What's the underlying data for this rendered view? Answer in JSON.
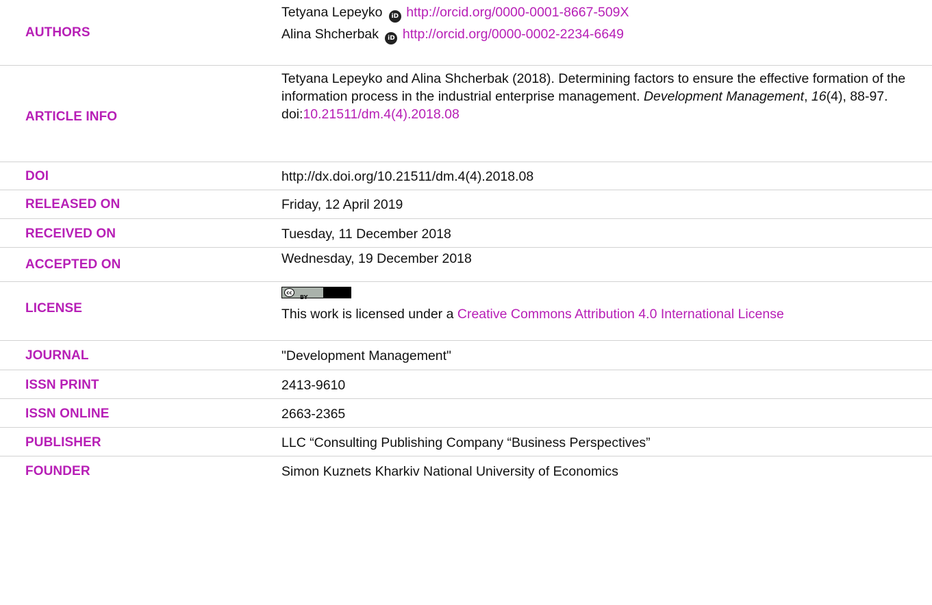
{
  "authors": {
    "label": "AUTHORS",
    "list": [
      {
        "name": "Tetyana Lepeyko",
        "orcid": "http://orcid.org/0000-0001-8667-509X"
      },
      {
        "name": "Alina Shcherbak",
        "orcid": "http://orcid.org/0000-0002-2234-6649"
      }
    ],
    "orcid_icon_text": "iD"
  },
  "article_info": {
    "label": "ARTICLE INFO",
    "citation_start": "Tetyana Lepeyko and Alina Shcherbak (2018). Determining factors to ensure the effective formation of the information process in the industrial enterprise management. ",
    "journal_italic": "Development Management",
    "sep1": ", ",
    "volume_italic": "16",
    "issue_pages": "(4), 88-97.",
    "doi_prefix": "doi:",
    "doi_link": "10.21511/dm.4(4).2018.08"
  },
  "doi": {
    "label": "DOI",
    "value": "http://dx.doi.org/10.21511/dm.4(4).2018.08"
  },
  "released": {
    "label": "RELEASED ON",
    "value": "Friday, 12 April 2019"
  },
  "received": {
    "label": "RECEIVED ON",
    "value": "Tuesday, 11 December 2018"
  },
  "accepted": {
    "label": "ACCEPTED ON",
    "value": "Wednesday, 19 December 2018"
  },
  "license": {
    "label": "LICENSE",
    "badge_cc": "cc",
    "badge_by": "BY",
    "text_prefix": "This work is licensed under a ",
    "link_text": "Creative Commons Attribution 4.0 International License"
  },
  "journal": {
    "label": "JOURNAL",
    "value": "\"Development Management\""
  },
  "issn_print": {
    "label": "ISSN PRINT",
    "value": "2413-9610"
  },
  "issn_online": {
    "label": "ISSN ONLINE",
    "value": "2663-2365"
  },
  "publisher": {
    "label": "PUBLISHER",
    "value": "LLC “Consulting Publishing Company “Business Perspectives”"
  },
  "founder": {
    "label": "FOUNDER",
    "value": "Simon Kuznets Kharkiv National University of Economics"
  },
  "colors": {
    "accent": "#b71fb6",
    "divider": "#d2d2d2",
    "text": "#111111"
  }
}
